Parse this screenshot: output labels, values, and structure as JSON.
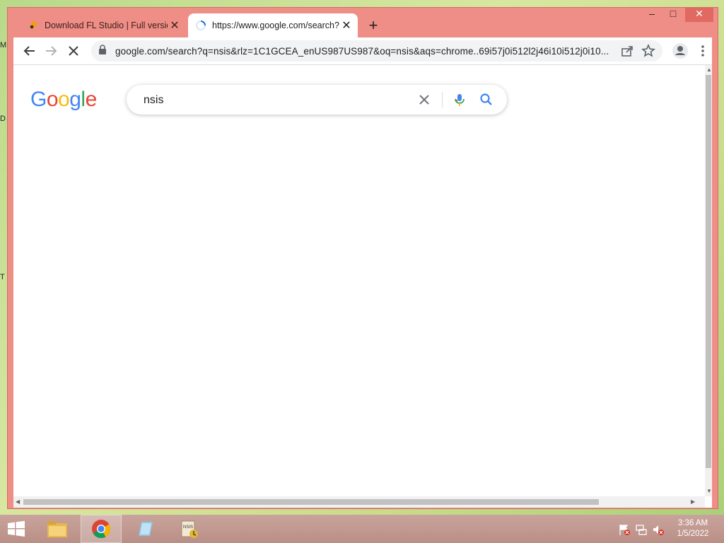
{
  "desktop": {
    "edge_letters": [
      "M",
      "D",
      "T"
    ]
  },
  "tabs": [
    {
      "title": "Download FL Studio | Full version",
      "active": false
    },
    {
      "title": "https://www.google.com/search?q",
      "active": true
    }
  ],
  "window_controls": {
    "minimize": "–",
    "maximize": "□",
    "close": "✕"
  },
  "new_tab_label": "+",
  "toolbar": {
    "url": "google.com/search?q=nsis&rlz=1C1GCEA_enUS987US987&oq=nsis&aqs=chrome..69i57j0i512l2j46i10i512j0i10..."
  },
  "page": {
    "logo_letters": [
      {
        "ch": "G",
        "color": "#4285F4"
      },
      {
        "ch": "o",
        "color": "#EA4335"
      },
      {
        "ch": "o",
        "color": "#FBBC05"
      },
      {
        "ch": "g",
        "color": "#4285F4"
      },
      {
        "ch": "l",
        "color": "#34A853"
      },
      {
        "ch": "e",
        "color": "#EA4335"
      }
    ],
    "search_value": "nsis"
  },
  "taskbar": {
    "apps": [
      "file-explorer",
      "chrome",
      "notepad",
      "nsis-installer"
    ],
    "clock": {
      "time": "3:36 AM",
      "date": "1/5/2022"
    }
  },
  "colors": {
    "window_frame": "#ef8e86",
    "google_blue": "#4285F4",
    "google_red": "#EA4335",
    "google_yellow": "#FBBC05",
    "google_green": "#34A853"
  }
}
